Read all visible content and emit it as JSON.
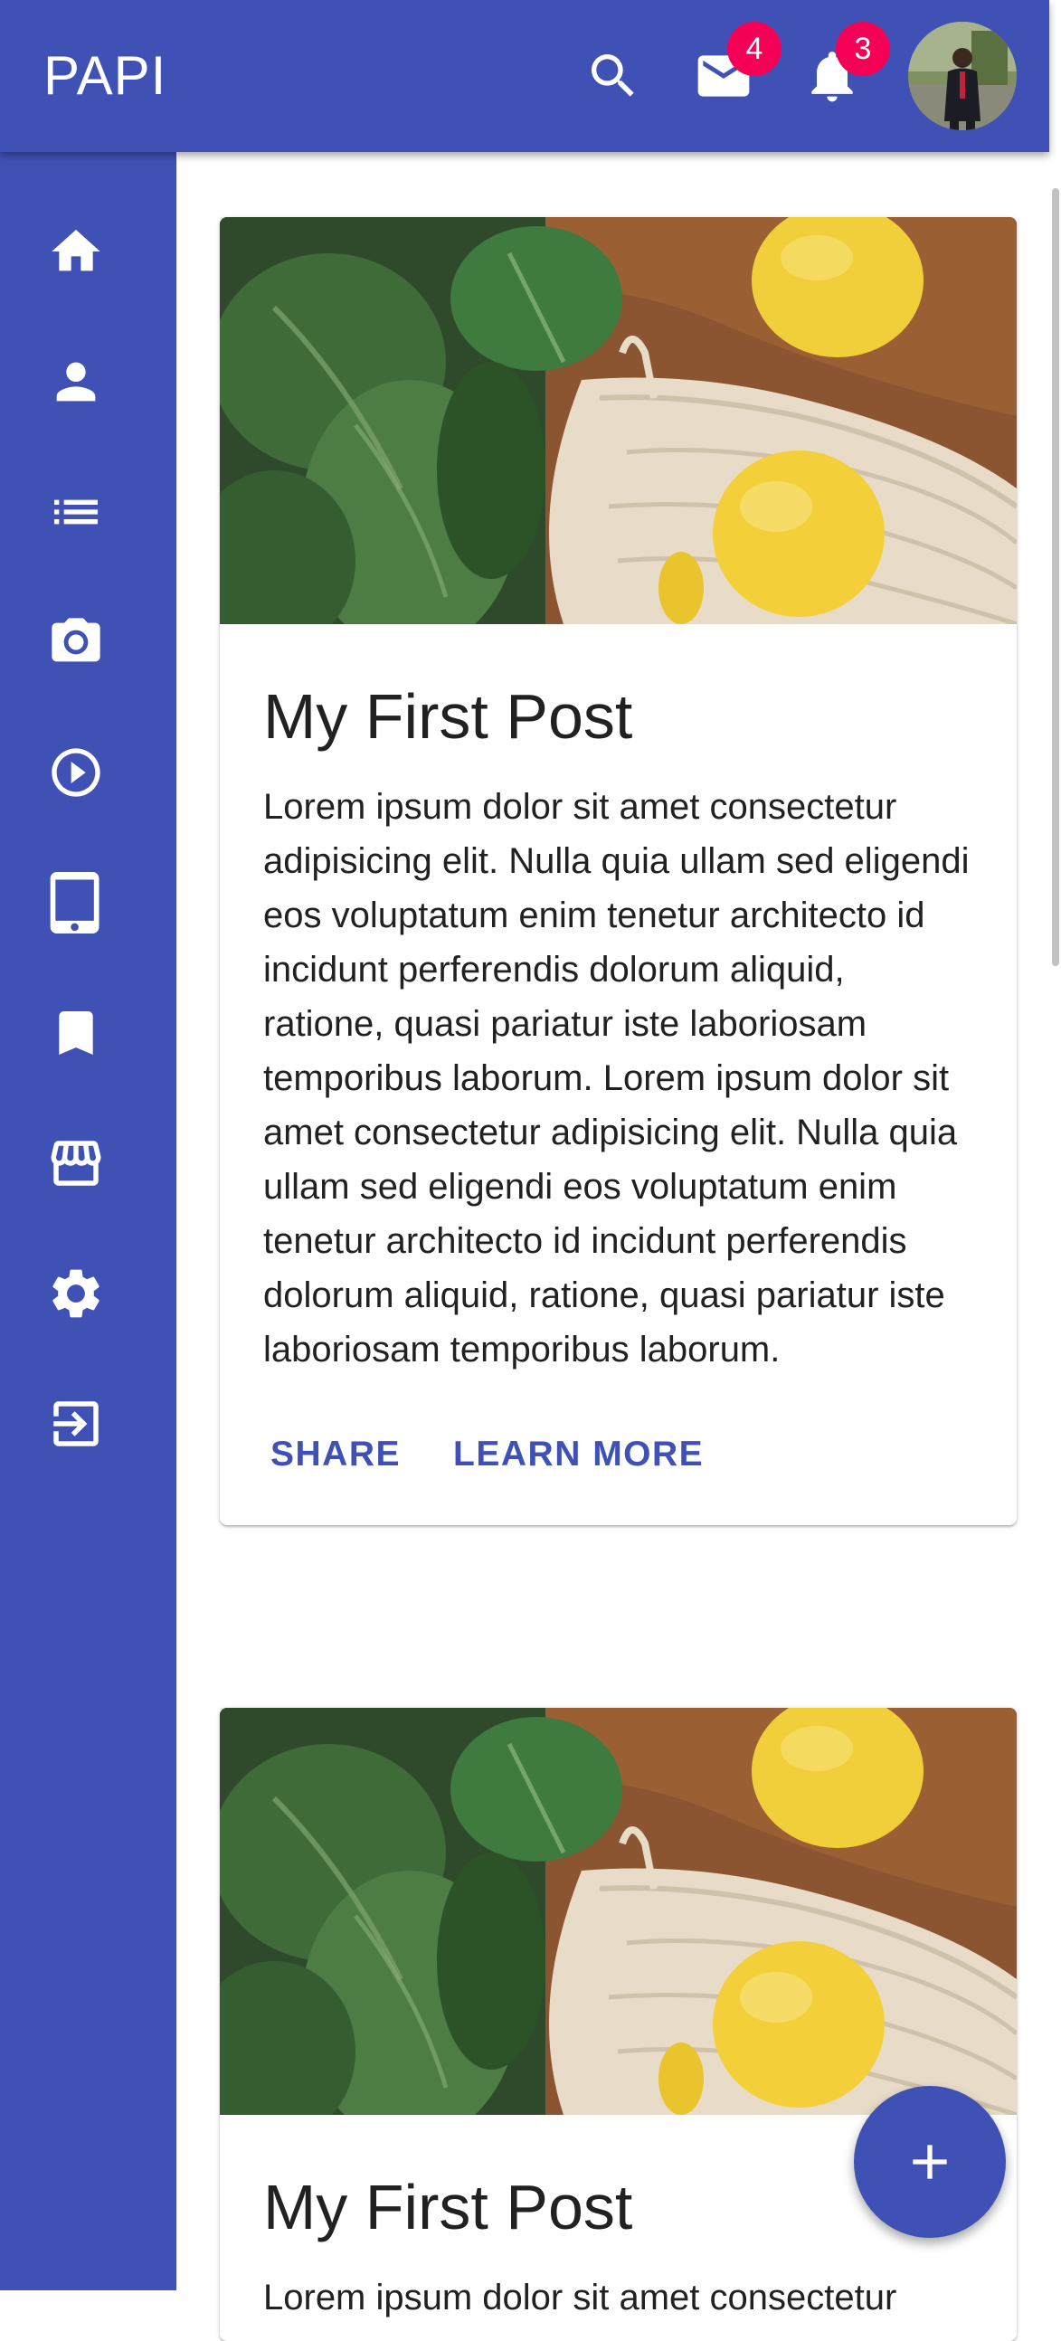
{
  "app_bar": {
    "title": "PAPI",
    "mail_badge": "4",
    "notifications_badge": "3",
    "icons": [
      "search-icon",
      "mail-icon",
      "notifications-icon",
      "user-avatar"
    ]
  },
  "sidebar": {
    "items": [
      {
        "icon": "home-icon"
      },
      {
        "icon": "person-icon"
      },
      {
        "icon": "list-icon"
      },
      {
        "icon": "camera-icon"
      },
      {
        "icon": "play-circle-icon"
      },
      {
        "icon": "tablet-icon"
      },
      {
        "icon": "bookmark-icon"
      },
      {
        "icon": "store-icon"
      },
      {
        "icon": "settings-icon"
      },
      {
        "icon": "logout-icon"
      }
    ]
  },
  "posts": [
    {
      "title": "My First Post",
      "body": "Lorem ipsum dolor sit amet consectetur adipisicing elit. Nulla quia ullam sed eligendi eos voluptatum enim tenetur architecto id incidunt perferendis dolorum aliquid, ratione, quasi pariatur iste laboriosam temporibus laborum. Lorem ipsum dolor sit amet consectetur adipisicing elit. Nulla quia ullam sed eligendi eos voluptatum enim tenetur architecto id incidunt perferendis dolorum aliquid, ratione, quasi pariatur iste laboriosam temporibus laborum.",
      "actions": [
        "SHARE",
        "LEARN MORE"
      ]
    },
    {
      "title": "My First Post",
      "body": "Lorem ipsum dolor sit amet consectetur"
    }
  ],
  "fab": {
    "icon": "add-icon"
  },
  "colors": {
    "primary": "#3f51b5",
    "badge": "#f50057",
    "text": "#212121"
  }
}
